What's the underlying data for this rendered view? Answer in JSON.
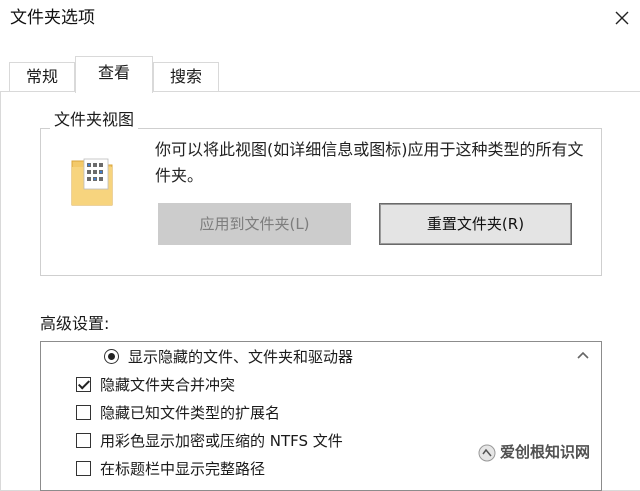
{
  "window": {
    "title": "文件夹选项"
  },
  "tabs": [
    {
      "label": "常规",
      "active": false
    },
    {
      "label": "查看",
      "active": true
    },
    {
      "label": "搜索",
      "active": false
    }
  ],
  "folder_views": {
    "legend": "文件夹视图",
    "description": "你可以将此视图(如详细信息或图标)应用于这种类型的所有文件夹。",
    "apply_button": "应用到文件夹(L)",
    "reset_button": "重置文件夹(R)"
  },
  "advanced": {
    "label": "高级设置:",
    "items": [
      {
        "type": "radio",
        "label": "显示隐藏的文件、文件夹和驱动器",
        "checked": true
      },
      {
        "type": "checkbox",
        "label": "隐藏文件夹合并冲突",
        "checked": true
      },
      {
        "type": "checkbox",
        "label": "隐藏已知文件类型的扩展名",
        "checked": false
      },
      {
        "type": "checkbox",
        "label": "用彩色显示加密或压缩的 NTFS 文件",
        "checked": false
      },
      {
        "type": "checkbox",
        "label": "在标题栏中显示完整路径",
        "checked": false
      }
    ]
  },
  "watermark": {
    "text": "爱创根知识网"
  },
  "icons": {
    "close": "close-icon",
    "folder": "folder-view-icon",
    "scroll_up": "scroll-up-arrow-icon"
  }
}
